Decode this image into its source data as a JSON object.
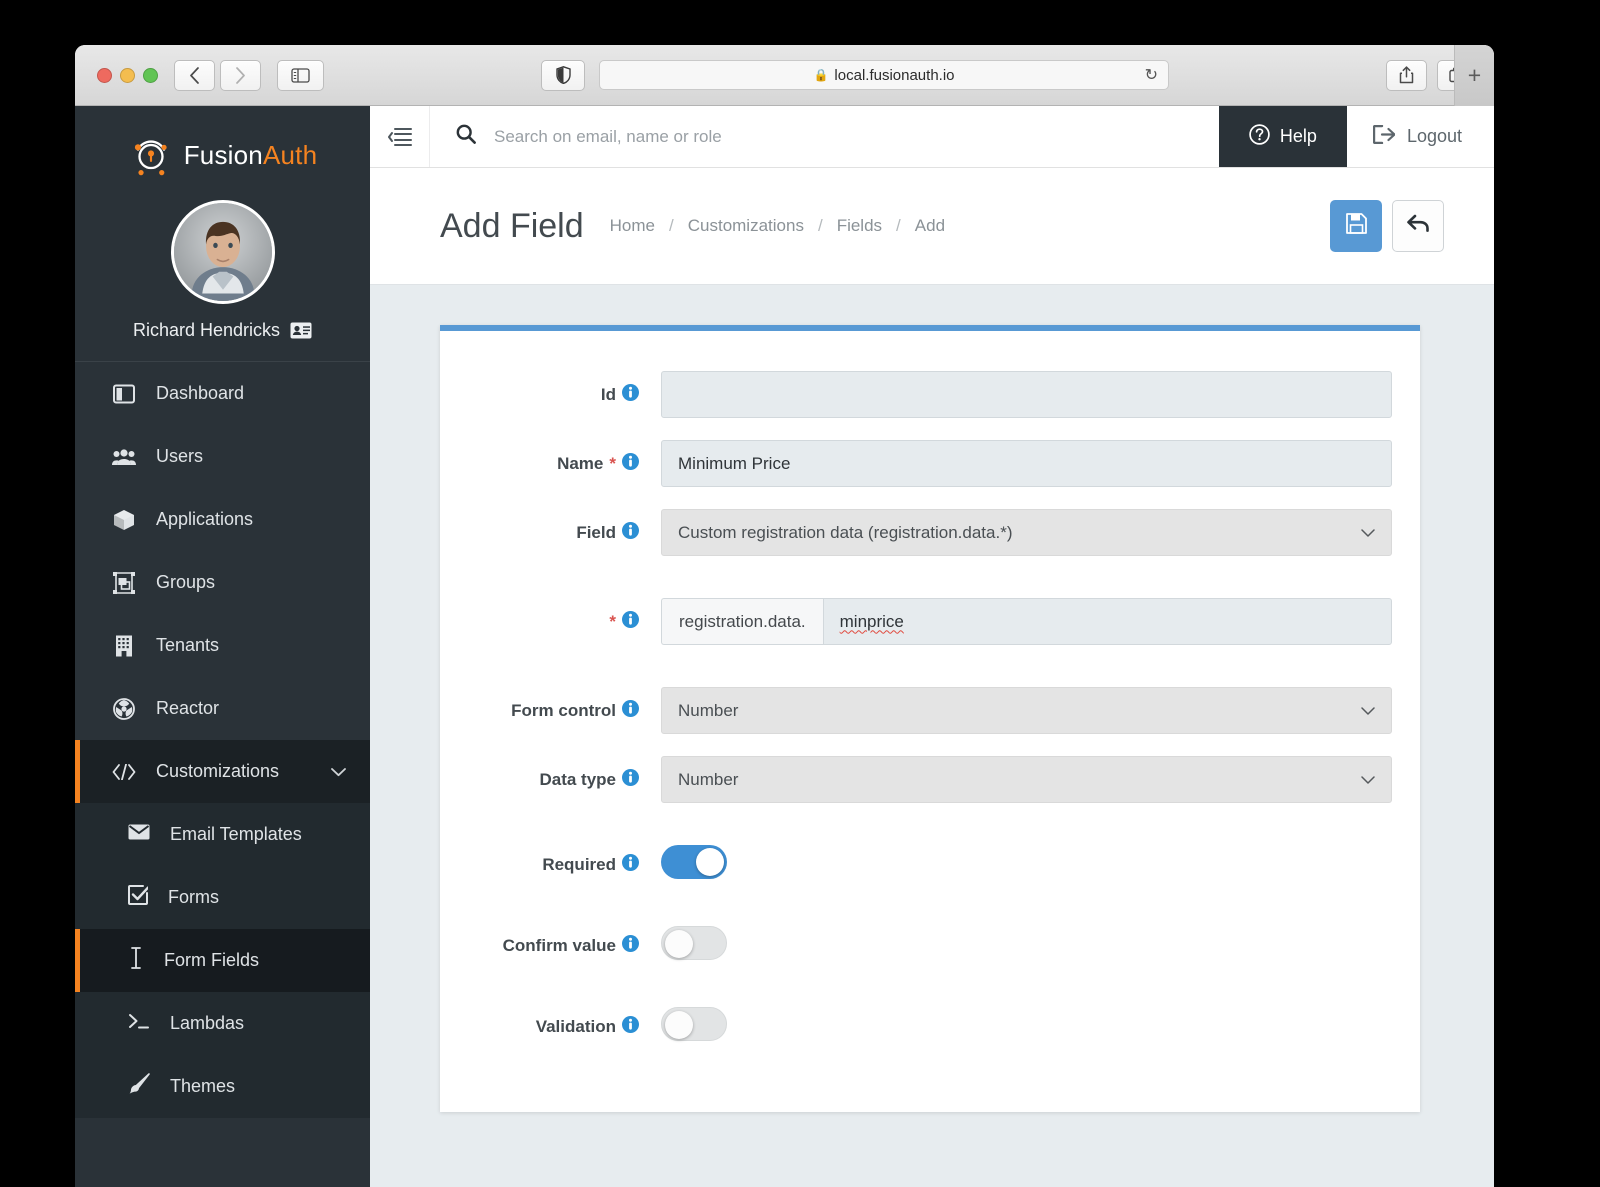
{
  "browser": {
    "url": "local.fusionauth.io",
    "lock_icon": "lock-icon",
    "back_icon": "chevron-left-icon",
    "forward_icon": "chevron-right-icon",
    "sidebar_icon": "sidebar-toggle-icon",
    "shield_icon": "shield-icon",
    "reload_icon": "reload-icon",
    "share_icon": "share-icon",
    "tabs_icon": "tab-overview-icon",
    "newtab_label": "+"
  },
  "sidebar": {
    "brand": {
      "first": "Fusion",
      "second": "Auth"
    },
    "user": {
      "name": "Richard Hendricks",
      "badge_icon": "id-card-icon"
    },
    "items": [
      {
        "label": "Dashboard",
        "icon": "dashboard-icon"
      },
      {
        "label": "Users",
        "icon": "users-icon"
      },
      {
        "label": "Applications",
        "icon": "applications-cube-icon"
      },
      {
        "label": "Groups",
        "icon": "groups-icon"
      },
      {
        "label": "Tenants",
        "icon": "tenants-building-icon"
      },
      {
        "label": "Reactor",
        "icon": "reactor-icon"
      }
    ],
    "group": {
      "label": "Customizations",
      "icon": "code-brackets-icon",
      "caret": "chevron-down-icon",
      "expanded": true
    },
    "subitems": [
      {
        "label": "Email Templates",
        "icon": "envelope-icon",
        "active": false
      },
      {
        "label": "Forms",
        "icon": "checkbox-icon",
        "active": false
      },
      {
        "label": "Form Fields",
        "icon": "text-cursor-icon",
        "active": true
      },
      {
        "label": "Lambdas",
        "icon": "terminal-icon",
        "active": false
      },
      {
        "label": "Themes",
        "icon": "paintbrush-icon",
        "active": false
      }
    ]
  },
  "topbar": {
    "menu_icon": "collapse-menu-icon",
    "search_placeholder": "Search on email, name or role",
    "search_value": "",
    "search_icon": "search-icon",
    "help_label": "Help",
    "help_icon": "question-circle-icon",
    "logout_label": "Logout",
    "logout_icon": "logout-icon"
  },
  "page": {
    "title": "Add Field",
    "breadcrumbs": [
      "Home",
      "Customizations",
      "Fields",
      "Add"
    ],
    "separator": "/",
    "actions": {
      "save_icon": "save-floppy-icon",
      "back_icon": "undo-arrow-icon"
    }
  },
  "form": {
    "fields": [
      {
        "label": "Id",
        "required": false,
        "type": "input",
        "value": ""
      },
      {
        "label": "Name",
        "required": true,
        "type": "input",
        "value": "Minimum Price"
      },
      {
        "label": "Field",
        "required": false,
        "type": "select",
        "value": "Custom registration data (registration.data.*)"
      },
      {
        "label": "",
        "required": true,
        "type": "grouped",
        "prefix": "registration.data.",
        "value": "minprice"
      },
      {
        "label": "Form control",
        "required": false,
        "type": "select",
        "value": "Number"
      },
      {
        "label": "Data type",
        "required": false,
        "type": "select",
        "value": "Number"
      },
      {
        "label": "Required",
        "required": false,
        "type": "toggle",
        "on": true
      },
      {
        "label": "Confirm value",
        "required": false,
        "type": "toggle",
        "on": false
      },
      {
        "label": "Validation",
        "required": false,
        "type": "toggle",
        "on": false
      }
    ],
    "info_icon": "info-circle-icon",
    "chevron_icon": "chevron-down-icon"
  },
  "colors": {
    "accent_blue": "#5899d4",
    "brand_orange": "#f58320",
    "sidebar_bg": "#2a3238",
    "submenu_bg": "#222a2f",
    "active_bg": "#161b1f",
    "required_red": "#d9534f",
    "toggle_on": "#3e8fd4"
  }
}
